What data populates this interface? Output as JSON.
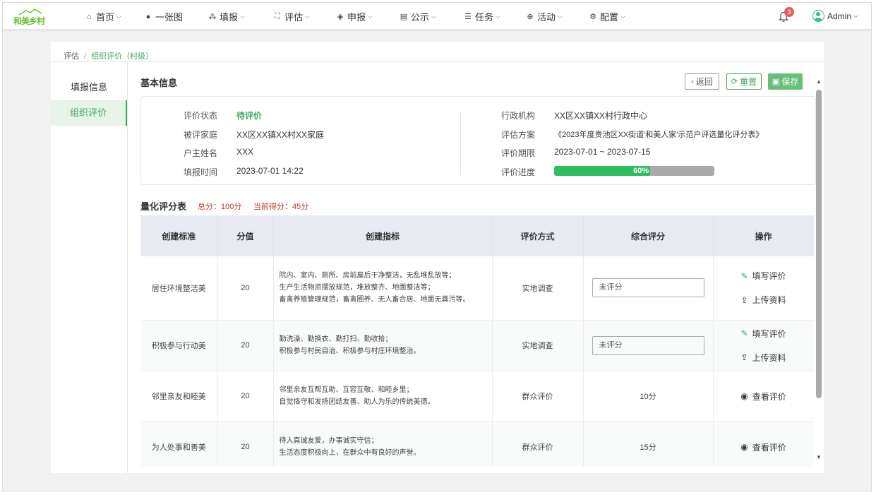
{
  "brand": {
    "logo_text": "和美乡村"
  },
  "nav": {
    "items": [
      {
        "label": "首页",
        "icon": "home-icon"
      },
      {
        "label": "一张图",
        "icon": "globe-icon"
      },
      {
        "label": "填报",
        "icon": "cubes-icon"
      },
      {
        "label": "评估",
        "icon": "scan-icon"
      },
      {
        "label": "申报",
        "icon": "layers-icon"
      },
      {
        "label": "公示",
        "icon": "newspaper-icon"
      },
      {
        "label": "任务",
        "icon": "list-icon"
      },
      {
        "label": "活动",
        "icon": "lifebuoy-icon"
      },
      {
        "label": "配置",
        "icon": "gear-icon"
      }
    ],
    "notification_count": "3",
    "user_name": "Admin"
  },
  "breadcrumb": {
    "parent": "评估",
    "current": "组织评价（村级）"
  },
  "sidebar": {
    "items": [
      {
        "label": "填报信息"
      },
      {
        "label": "组织评价"
      }
    ]
  },
  "basic_info": {
    "title": "基本信息",
    "buttons": {
      "back": "返回",
      "reset": "重置",
      "save": "保存"
    },
    "left": [
      {
        "label": "评价状态",
        "value": "待评价"
      },
      {
        "label": "被评家庭",
        "value": "XX区XX镇XX村XX家庭"
      },
      {
        "label": "户主姓名",
        "value": "XXX"
      },
      {
        "label": "填报时间",
        "value": "2023-07-01 14:22"
      }
    ],
    "right": [
      {
        "label": "行政机构",
        "value": "XX区XX镇XX村行政中心"
      },
      {
        "label": "评估方案",
        "value": "《2023年度贵池区XX街道'和美人家'示范户评选量化评分表》"
      },
      {
        "label": "评价期限",
        "value": "2023-07-01 ~ 2023-07-15"
      },
      {
        "label": "评价进度",
        "value": "60%"
      }
    ],
    "progress_fraction": 0.6
  },
  "score_table": {
    "title": "量化评分表",
    "total": "总分：100分",
    "current": "当前得分：45分",
    "headers": [
      "创建标准",
      "分值",
      "创建指标",
      "评价方式",
      "综合评分",
      "操作"
    ],
    "rows": [
      {
        "standard": "居住环境整洁美",
        "score": "20",
        "indicators": [
          "院内、室内、厕所、房前屋后干净整洁，无乱堆乱放等；",
          "生产生活物资摆放规范，堆放整齐、地面整洁等；",
          "畜禽养殖管理规范，畜禽圈养、无人畜合居、地面无粪污等。"
        ],
        "method": "实地调查",
        "eval_placeholder": "未评分",
        "actions": [
          "填写评价",
          "上传资料"
        ]
      },
      {
        "standard": "积极参与行动美",
        "score": "20",
        "indicators": [
          "勤洗澡、勤换衣、勤打扫、勤收拾；",
          "积极参与村民自治、积极参与村庄环境整治。"
        ],
        "method": "实地调查",
        "eval_placeholder": "未评分",
        "actions": [
          "填写评价",
          "上传资料"
        ]
      },
      {
        "standard": "邻里亲友和睦美",
        "score": "20",
        "indicators": [
          "邻里亲友互帮互助、互容互敬、和睦乡里；",
          "自觉恪守和发扬团结友善、助人为乐的传统美德。"
        ],
        "method": "群众评价",
        "eval_value": "10分",
        "actions": [
          "查看评价"
        ]
      },
      {
        "standard": "为人处事和善美",
        "score": "20",
        "indicators": [
          "待人真诚友爱，办事诚实守信；",
          "生活态度积极向上，在群众中有良好的声誉。"
        ],
        "method": "群众评价",
        "eval_value": "15分",
        "actions": [
          "查看评价"
        ]
      }
    ]
  },
  "colors": {
    "accent": "#41a85f",
    "progress": "#2ebd5f",
    "warning": "#c0392b",
    "badge": "#e85b5b"
  }
}
